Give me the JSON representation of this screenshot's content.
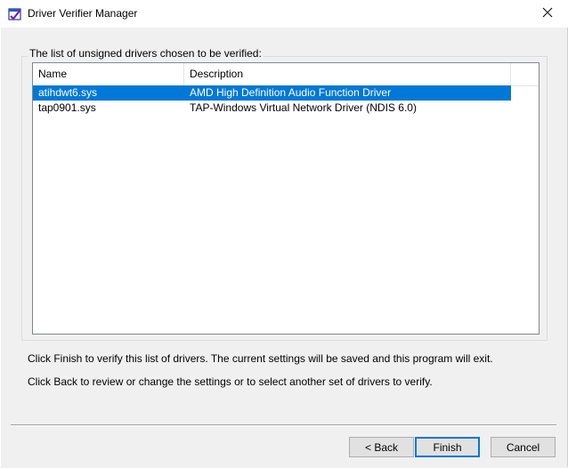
{
  "window": {
    "title": "Driver Verifier Manager",
    "icon": "driver-verifier-icon",
    "close_icon": "close-icon"
  },
  "group": {
    "label": "The list of unsigned drivers chosen to be verified:"
  },
  "list": {
    "columns": [
      "Name",
      "Description"
    ],
    "rows": [
      {
        "name": "atihdwt6.sys",
        "description": "AMD High Definition Audio Function Driver",
        "selected": true
      },
      {
        "name": "tap0901.sys",
        "description": "TAP-Windows Virtual Network Driver (NDIS 6.0)",
        "selected": false
      }
    ]
  },
  "info": {
    "finish_text": "Click Finish to verify this list of drivers. The current settings will be saved and this program will exit.",
    "back_text": "Click Back to review or change the settings or to select another set of drivers to verify."
  },
  "buttons": {
    "back_label": "< Back",
    "finish_label": "Finish",
    "cancel_label": "Cancel"
  },
  "colors": {
    "selection": "#0078d7",
    "default_button_border": "#0078d7",
    "background": "#f0f0f0"
  }
}
